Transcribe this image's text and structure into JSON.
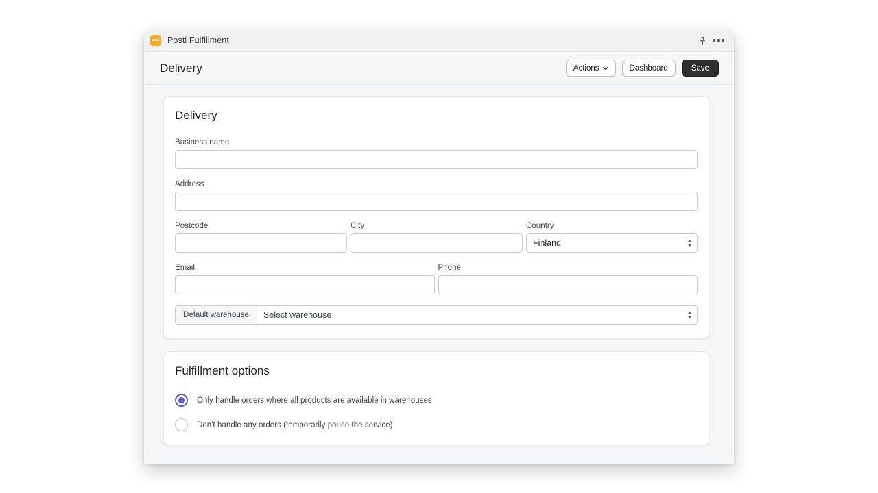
{
  "window": {
    "app_icon_text": "posti",
    "app_icon_name": "posti-app-icon",
    "app_icon_color": "#f5a623",
    "title": "Posti Fulfillment",
    "pin_icon": "pin-icon",
    "more_icon": "more-options-icon",
    "more_glyph": "•••"
  },
  "header": {
    "title": "Delivery",
    "actions_label": "Actions",
    "actions_chevron": "▼",
    "dashboard_label": "Dashboard",
    "save_label": "Save",
    "save_bg": "#2e2e2e"
  },
  "delivery_card": {
    "title": "Delivery",
    "fields": {
      "business_name": {
        "label": "Business name",
        "value": "",
        "placeholder": ""
      },
      "address": {
        "label": "Address",
        "value": "",
        "placeholder": ""
      },
      "postcode": {
        "label": "Postcode",
        "value": "",
        "placeholder": ""
      },
      "city": {
        "label": "City",
        "value": "",
        "placeholder": ""
      },
      "country": {
        "label": "Country",
        "value": "Finland",
        "options": [
          "Finland"
        ]
      },
      "email": {
        "label": "Email",
        "value": "",
        "placeholder": ""
      },
      "phone": {
        "label": "Phone",
        "value": "",
        "placeholder": ""
      }
    },
    "warehouse_group": {
      "prefix_label": "Default warehouse",
      "value": "Select warehouse",
      "options": [
        "Select warehouse"
      ]
    }
  },
  "fulfillment_card": {
    "title": "Fulfillment options",
    "selected_index": 0,
    "accent_color": "#5c5fd9",
    "options": [
      {
        "label": "Only handle orders where all products are available in warehouses",
        "checked": true
      },
      {
        "label": "Don't handle any orders (temporarily pause the service)",
        "checked": false
      }
    ]
  }
}
